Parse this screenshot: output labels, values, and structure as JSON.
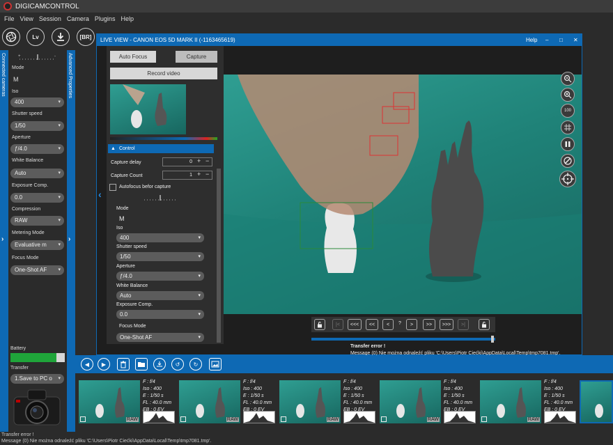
{
  "app": {
    "title": "DIGICAMCONTROL"
  },
  "menu": [
    "File",
    "View",
    "Session",
    "Camera",
    "Plugins",
    "Help"
  ],
  "toolbar": {
    "lv_label": "Lv",
    "br_label": "[BR]"
  },
  "sidebars": {
    "left_label": "Connected cameras",
    "mid_label": "Advanced Properties"
  },
  "left_panel": {
    "mode_label": "Mode",
    "mode_value": "M",
    "iso_label": "Iso",
    "iso_value": "400",
    "shutter_label": "Shutter speed",
    "shutter_value": "1/50",
    "aperture_label": "Aperture",
    "aperture_value": "ƒ/4.0",
    "wb_label": "White Balance",
    "wb_value": "Auto",
    "exp_label": "Exposure Comp.",
    "exp_value": "0.0",
    "compression_label": "Compression",
    "compression_value": "RAW",
    "metering_label": "Metering Mode",
    "metering_value": "Evaluative m",
    "focus_label": "Focus Mode",
    "focus_value": "One-Shot AF",
    "battery_label": "Battery",
    "battery_level": 0.85,
    "transfer_label": "Transfer",
    "transfer_value": "1.Save to PC o"
  },
  "liveview": {
    "title": "LIVE VIEW - CANON EOS 5D MARK II (-1163465619)",
    "help": "Help",
    "min": "‒",
    "max": "□",
    "close": "✕",
    "autofocus_btn": "Auto Focus",
    "capture_btn": "Capture",
    "record_btn": "Record video",
    "section": "Control",
    "capture_delay_label": "Capture delay",
    "capture_delay_value": "0",
    "capture_count_label": "Capture Count",
    "capture_count_value": "1",
    "af_checkbox_label": "Autofocus befor capture",
    "mode_label": "Mode",
    "mode_value": "M",
    "iso_label": "Iso",
    "iso_value": "400",
    "shutter_label": "Shutter speed",
    "shutter_value": "1/50",
    "aperture_label": "Aperture",
    "aperture_value": "ƒ/4.0",
    "wb_label": "White Balance",
    "wb_value": "Auto",
    "exp_label": "Exposure Comp.",
    "exp_value": "0.0",
    "focus_label": "Focus Mode",
    "focus_value": "One-Shot AF",
    "zoom100": "100",
    "nav": {
      "first": "|<",
      "fast_back": "<<<",
      "back2": "<<",
      "back1": "<",
      "mid": "?",
      "fwd1": ">",
      "fwd2": ">>",
      "fast_fwd": ">>>",
      "last": ">|"
    },
    "error_title": "Transfer error !",
    "error_message": "Message (0) Nie można odnaleźć pliku 'C:\\Users\\Piotr Ciećki\\AppData\\Local\\Temp\\tmp7081.tmp'."
  },
  "thumbnails": [
    {
      "f": "F : f/4",
      "iso": "Iso : 400",
      "e": "E : 1/50 s",
      "fl": "FL : 40.0 mm",
      "eb": "EB : 0 EV",
      "tag": "RAW"
    },
    {
      "f": "F : f/4",
      "iso": "Iso : 400",
      "e": "E : 1/50 s",
      "fl": "FL : 40.0 mm",
      "eb": "EB : 0 EV",
      "tag": "RAW"
    },
    {
      "f": "F : f/4",
      "iso": "Iso : 400",
      "e": "E : 1/50 s",
      "fl": "FL : 40.0 mm",
      "eb": "EB : 0 EV",
      "tag": "RAW"
    },
    {
      "f": "F : f/4",
      "iso": "Iso : 400",
      "e": "E : 1/50 s",
      "fl": "FL : 40.0 mm",
      "eb": "EB : 0 EV",
      "tag": "RAW"
    },
    {
      "f": "F : f/4",
      "iso": "Iso : 400",
      "e": "E : 1/50 s",
      "fl": "FL : 40.0 mm",
      "eb": "EB : 0 EV",
      "tag": "RAW"
    }
  ],
  "status": {
    "line1": "Transfer error !",
    "line2": "Message (0) Nie można odnaleźć pliku 'C:\\Users\\Piotr Ciećki\\AppData\\Local\\Temp\\tmp7081.tmp'."
  }
}
